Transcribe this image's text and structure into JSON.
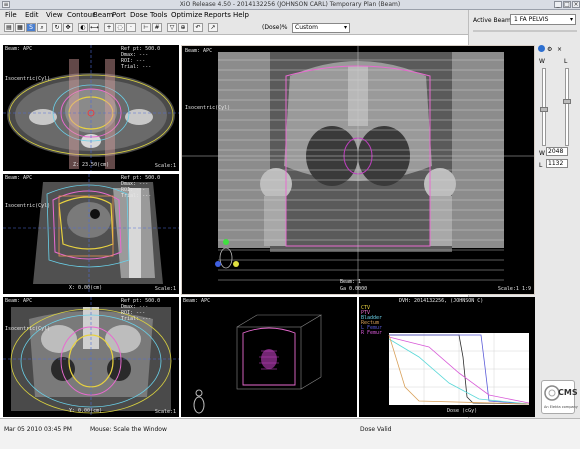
{
  "window": {
    "title": "XiO  Release 4.50 - 2014132256 (JOHNSON CARL)  Temporary Plan (Beam)"
  },
  "menu": [
    "File",
    "Edit",
    "View",
    "Contour",
    "Beam",
    "Port",
    "Dose",
    "Tools",
    "Optimize",
    "Reports",
    "Help"
  ],
  "toolbar": {
    "dose_label": "(Dose)%",
    "dose_select": "Custom"
  },
  "right_panel": {
    "active_beam_label": "Active Beam:",
    "active_beam_value": "1 FA PELVIS",
    "slider_labels": [
      "W",
      "L"
    ],
    "w_value": "2048",
    "l_value": "1132",
    "logo_text": "CMS",
    "logo_sub": "An Elekta company"
  },
  "panes": {
    "axial": {
      "top_left": "Beam: APC",
      "orientation": "Isocentric(Cyl)",
      "right_info": [
        "Ref pt: 500.0",
        "Dmax: ---",
        "ROI: ---",
        "Trial: ---"
      ],
      "bottom_left": "Z: 23.50(cm)",
      "scale": "Scale:1"
    },
    "sagittal": {
      "top_left": "Beam: APC",
      "orientation": "Isocentric(Cyl)",
      "right_info": [
        "Ref pt: 500.0",
        "Dmax: ---",
        "ROI: ---",
        "Trial: ---"
      ],
      "bottom_left": "X: 0.00(cm)",
      "scale": "Scale:1"
    },
    "coronal": {
      "top_left": "Beam: APC",
      "orientation": "Isocentric(Cyl)",
      "right_info": [
        "Ref pt: 500.0",
        "Dmax: ---",
        "ROI: ---",
        "Trial: ---"
      ],
      "bottom_left": "Y: 0.00(cm)",
      "scale": "Scale:1"
    },
    "bev": {
      "top_left": "Beam: APC",
      "orientation": "Isocentric(Cyl)",
      "bottom_right": "Scale:1  1:9",
      "bottom_center": "Beam: 1",
      "gantry": "Ga 0.0000"
    },
    "three_d": {
      "top_left": "Beam: APC"
    },
    "dvh": {
      "title": "DVH: 2014132256, (JOHNSON C)",
      "legend": [
        "CTV",
        "PTV",
        "Bladder",
        "Rectum",
        "L Femur",
        "R Femur"
      ],
      "xlabel": "Dose (cGy)"
    }
  },
  "status": {
    "time": "Mar 05 2010 03:45 PM",
    "mode": "Mouse: Scale the Window",
    "dose": "Dose Valid"
  },
  "colors": {
    "bev_border": "#d9d0c8",
    "menu_bg": "#e6e6e6",
    "panel_bg": "#e8e8e8"
  }
}
